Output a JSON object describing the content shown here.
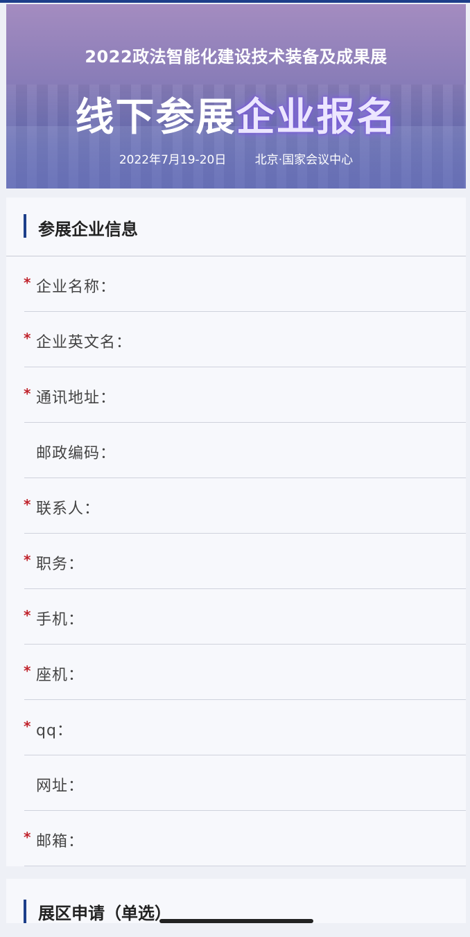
{
  "banner": {
    "subtitle": "2022政法智能化建设技术装备及成果展",
    "title_plain": "线下参展",
    "title_highlight": "企业报名",
    "date": "2022年7月19-20日",
    "venue": "北京·国家会议中心"
  },
  "section1": {
    "title": "参展企业信息",
    "fields": [
      {
        "label": "企业名称：",
        "required": "*"
      },
      {
        "label": "企业英文名：",
        "required": "*"
      },
      {
        "label": "通讯地址：",
        "required": "*"
      },
      {
        "label": "邮政编码：",
        "required": ""
      },
      {
        "label": "联系人：",
        "required": "*"
      },
      {
        "label": "职务：",
        "required": "*"
      },
      {
        "label": "手机：",
        "required": "*"
      },
      {
        "label": "座机：",
        "required": "*"
      },
      {
        "label": "qq：",
        "required": "*"
      },
      {
        "label": "网址：",
        "required": ""
      },
      {
        "label": "邮箱：",
        "required": "*"
      }
    ]
  },
  "section2": {
    "title": "展区申请（单选）"
  },
  "colors": {
    "accent": "#1d3f8a",
    "required": "#c0222b"
  }
}
